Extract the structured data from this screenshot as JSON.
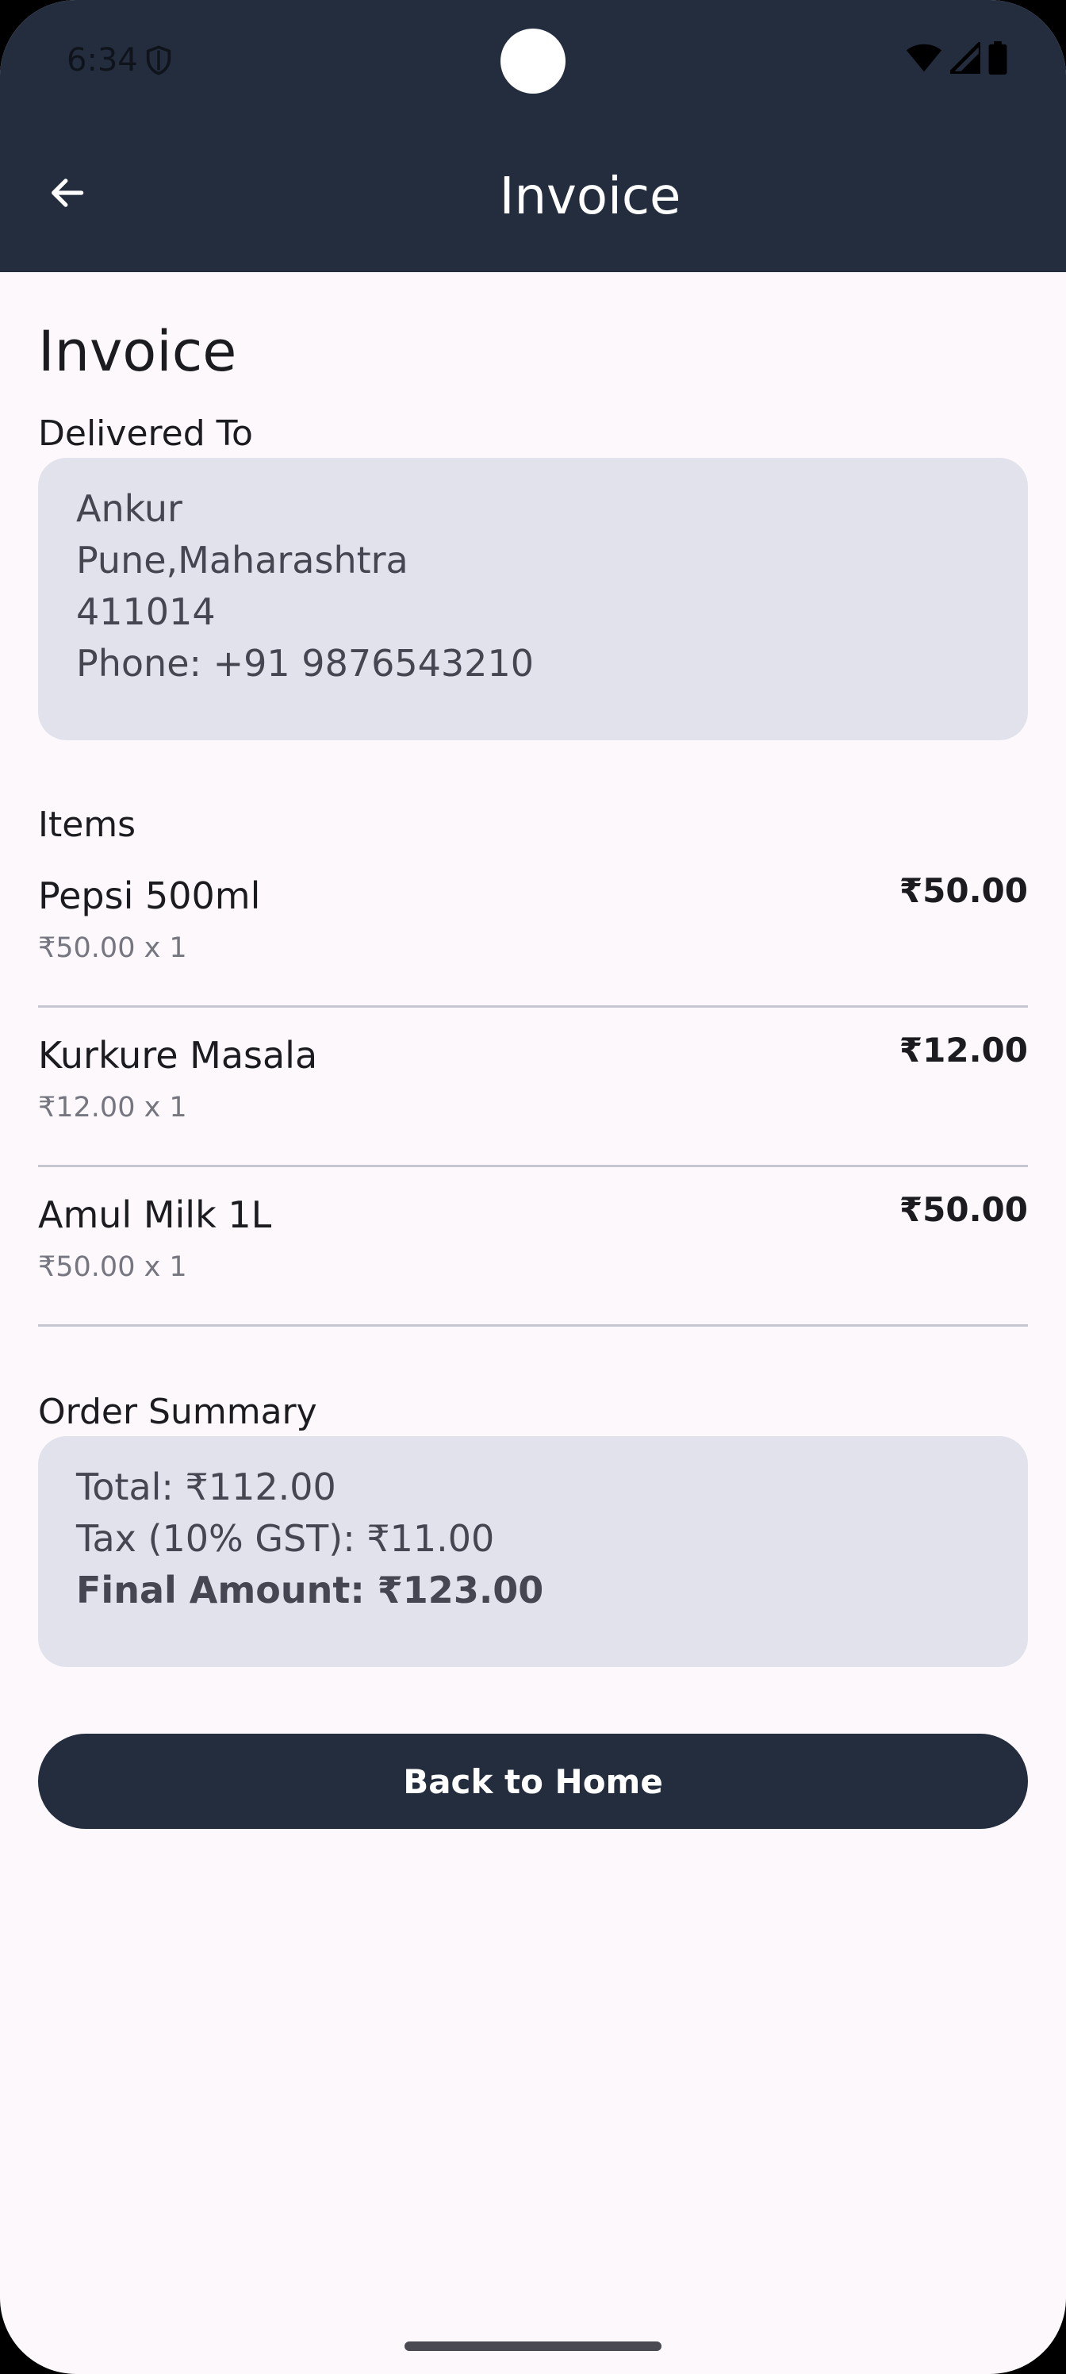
{
  "status_bar": {
    "time": "6:34",
    "icons": [
      "shield-icon",
      "wifi-icon",
      "signal-icon",
      "battery-icon"
    ]
  },
  "app_bar": {
    "title": "Invoice",
    "back_icon": "arrow-left-icon"
  },
  "page": {
    "heading": "Invoice"
  },
  "delivery": {
    "label": "Delivered To",
    "name": "Ankur",
    "city": "Pune,Maharashtra",
    "pincode": "411014",
    "phone": "Phone: +91 9876543210"
  },
  "items": {
    "label": "Items",
    "list": [
      {
        "name": "Pepsi 500ml",
        "detail": "₹50.00 x 1",
        "price": "₹50.00"
      },
      {
        "name": "Kurkure Masala",
        "detail": "₹12.00 x 1",
        "price": "₹12.00"
      },
      {
        "name": "Amul Milk 1L",
        "detail": "₹50.00 x 1",
        "price": "₹50.00"
      }
    ]
  },
  "summary": {
    "label": "Order Summary",
    "total": "Total: ₹112.00",
    "tax": "Tax (10% GST): ₹11.00",
    "final": "Final Amount: ₹123.00"
  },
  "actions": {
    "home_label": "Back to Home"
  },
  "colors": {
    "app_bar": "#232d3e",
    "background": "#fcf8fc",
    "card": "#e1e2eb",
    "button": "#232d3e"
  }
}
